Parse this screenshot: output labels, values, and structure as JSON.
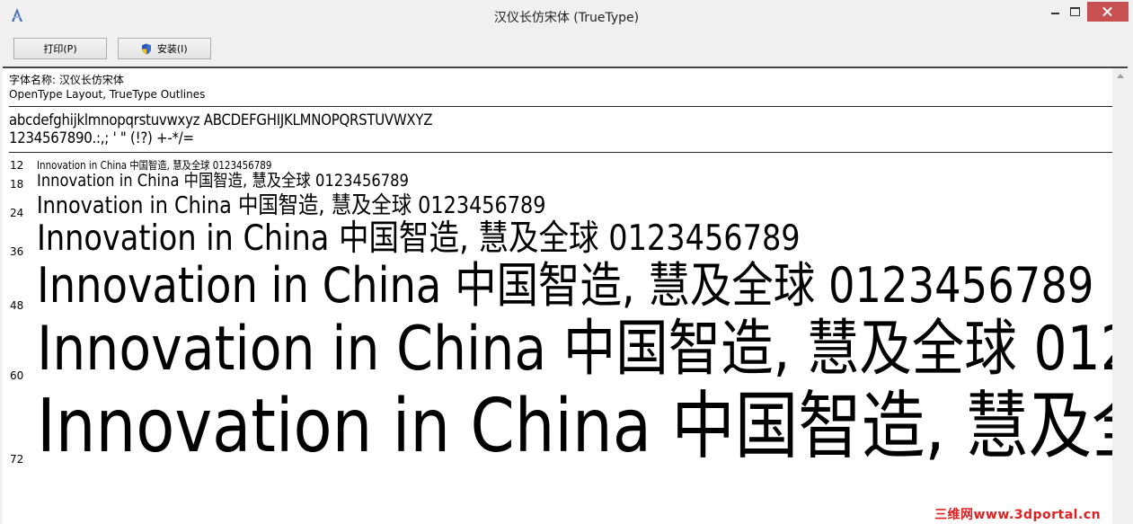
{
  "window": {
    "title": "汉仪长仿宋体 (TrueType)"
  },
  "toolbar": {
    "print_label": "打印(P)",
    "install_label": "安装(I)"
  },
  "info": {
    "font_name": "字体名称: 汉仪长仿宋体",
    "font_type": "OpenType Layout, TrueType Outlines"
  },
  "charset": {
    "letters": "abcdefghijklmnopqrstuvwxyz ABCDEFGHIJKLMNOPQRSTUVWXYZ",
    "digits": "1234567890.:,; ' \" (!?) +-*/="
  },
  "samples": {
    "text": "Innovation in China 中国智造, 慧及全球 0123456789",
    "sizes": [
      "12",
      "18",
      "24",
      "36",
      "48",
      "60",
      "72"
    ]
  },
  "watermark": "三维网www.3dportal.cn"
}
